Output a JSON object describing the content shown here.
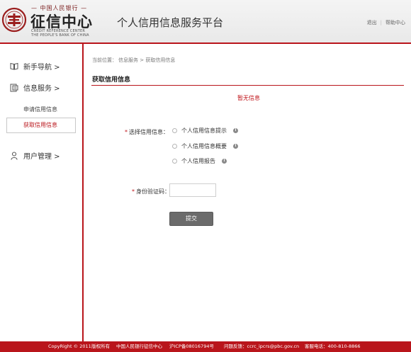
{
  "header": {
    "logo": {
      "top_text": "— 中国人民银行 —",
      "name": "征信中心",
      "en_line1": "CREDIT REFERENCE CENTER",
      "en_line2": "THE PEOPLE'S BANK OF CHINA"
    },
    "platform_title": "个人信用信息服务平台",
    "links": {
      "logout": "退出",
      "separator": "|",
      "help": "帮助中心"
    }
  },
  "sidebar": {
    "items": [
      {
        "label": "新手导航 >",
        "icon": "book-icon"
      },
      {
        "label": "信息服务 >",
        "icon": "document-icon"
      },
      {
        "label": "用户管理 >",
        "icon": "user-icon"
      }
    ],
    "sub_items": [
      {
        "label": "申请信用信息"
      },
      {
        "label": "获取信用信息",
        "active": true
      }
    ]
  },
  "main": {
    "breadcrumb": {
      "prefix": "当前位置：",
      "path": "信息服务 > 获取信用信息"
    },
    "section_title": "获取信用信息",
    "status_message": "暂无信息",
    "form": {
      "required_mark": "*",
      "select_label": "选择信用信息：",
      "options": [
        {
          "label": "个人信用信息提示",
          "selected": false
        },
        {
          "label": "个人信用信息概要",
          "selected": false
        },
        {
          "label": "个人信用报告",
          "selected": false
        }
      ],
      "info_glyph": "i",
      "code_label": "身份验证码：",
      "code_value": "",
      "submit_label": "提交"
    }
  },
  "footer": {
    "copyright": "CopyRight © 2011",
    "rights": "版权所有",
    "owner": "中国人民银行征信中心",
    "icp": "沪ICP备08016794号",
    "feedback": "问题反馈：ccrc_ipcrs@pbc.gov.cn",
    "phone": "客服电话：400-810-8866"
  },
  "colors": {
    "accent": "#b9151b",
    "error": "#c0161b",
    "button": "#6b6b6b"
  }
}
